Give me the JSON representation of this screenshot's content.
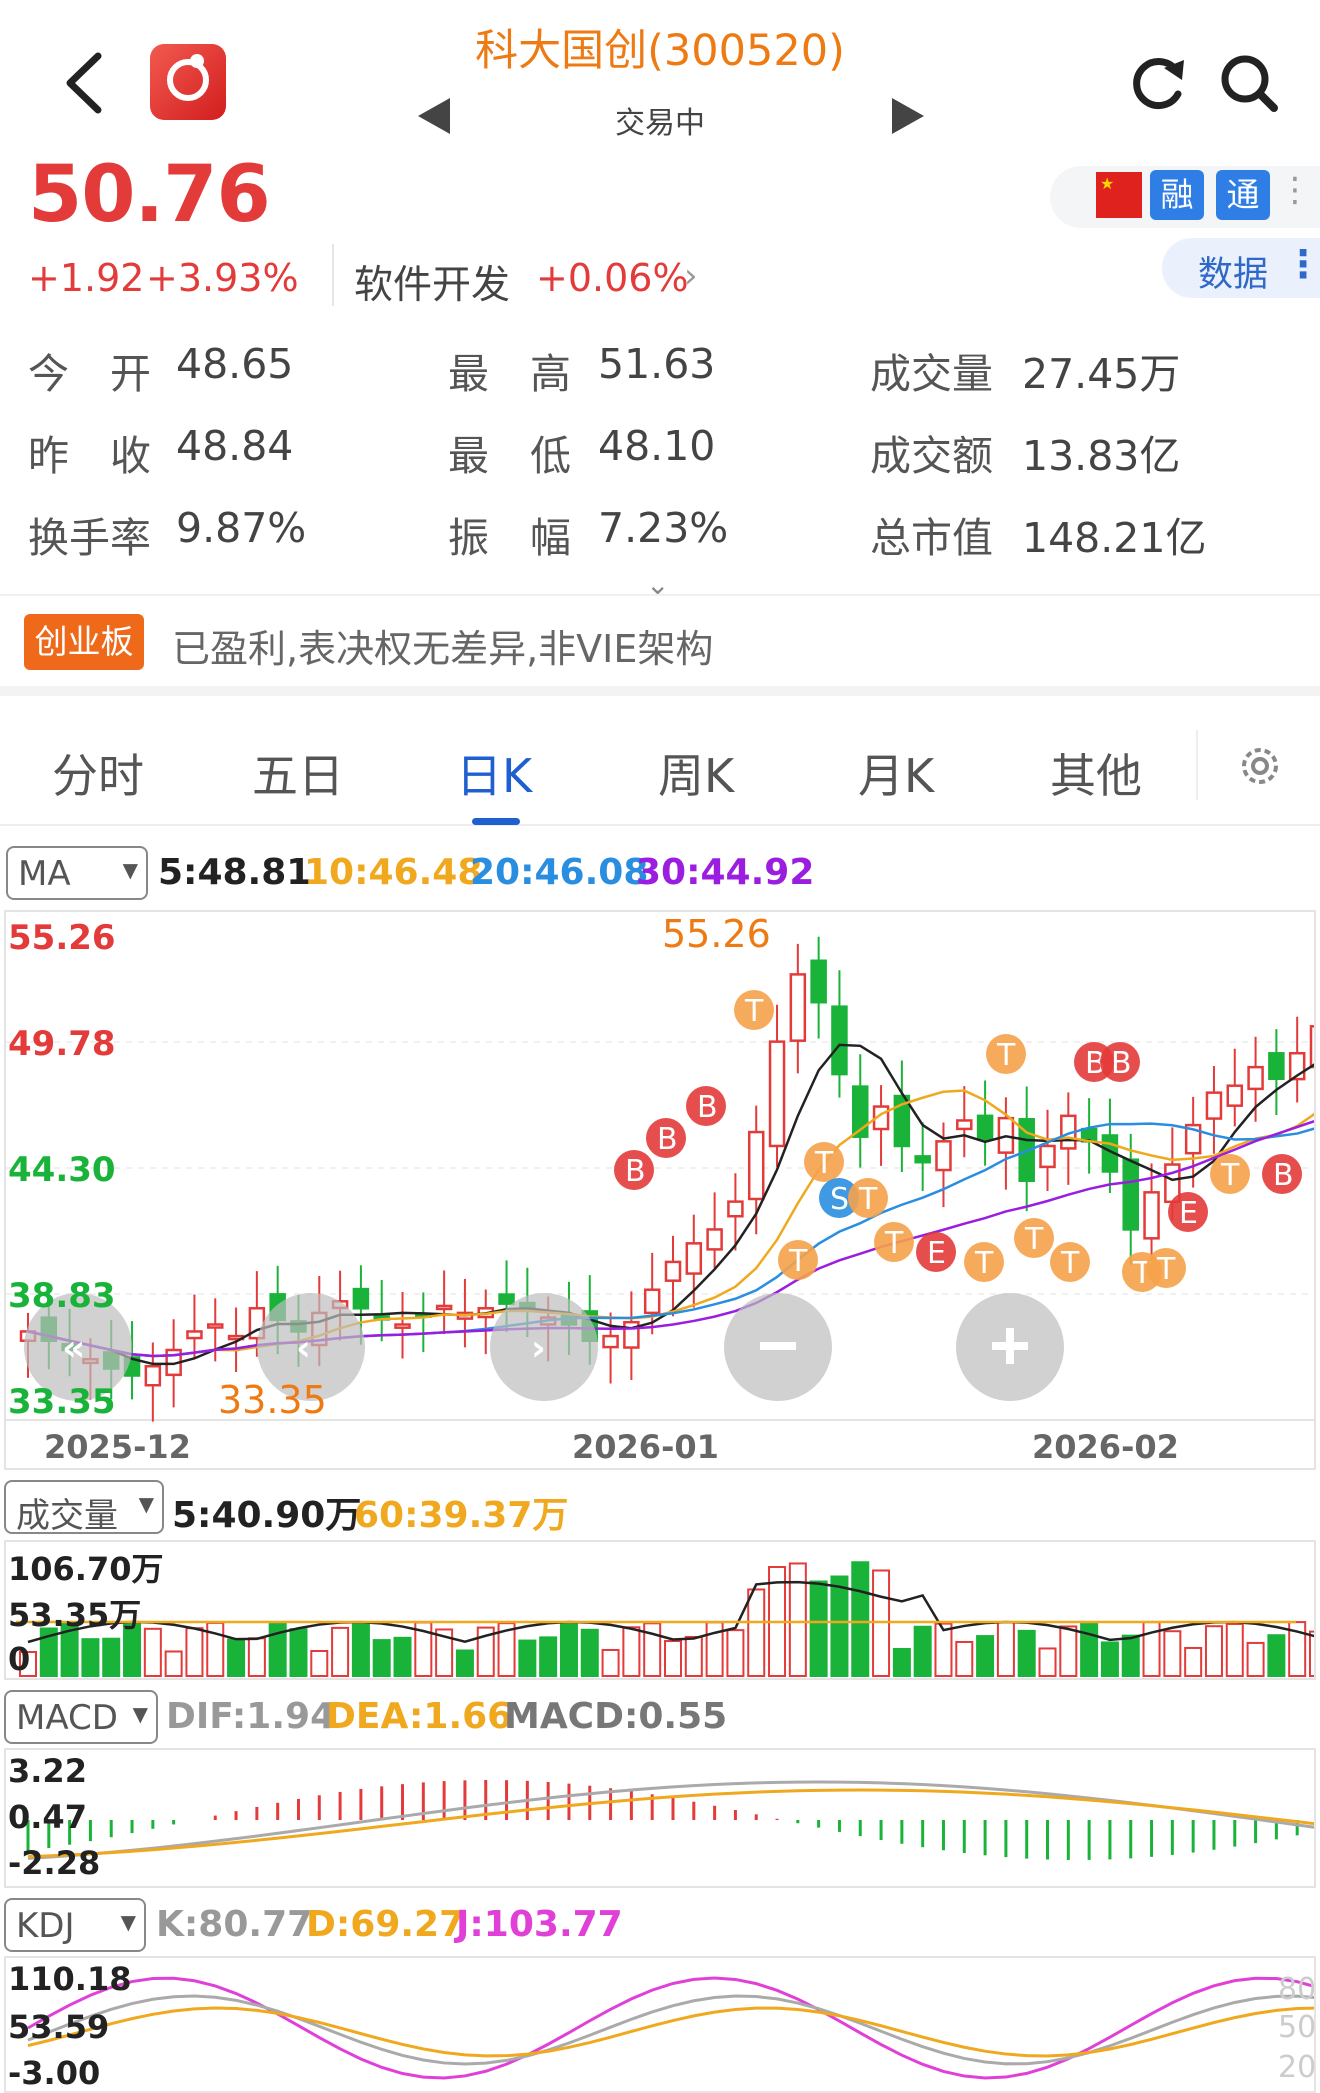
{
  "header": {
    "title": "科大国创(300520)",
    "status": "交易中"
  },
  "quote": {
    "price": "50.76",
    "change": "+1.92",
    "change_pct": "+3.93%",
    "sector": "软件开发",
    "sector_pct": "+0.06%",
    "tags": [
      "融",
      "通"
    ],
    "data_button": "数据"
  },
  "stats": [
    {
      "label": "今　开",
      "value": "48.65"
    },
    {
      "label": "最　高",
      "value": "51.63"
    },
    {
      "label": "成交量",
      "value": "27.45万"
    },
    {
      "label": "昨　收",
      "value": "48.84"
    },
    {
      "label": "最　低",
      "value": "48.10"
    },
    {
      "label": "成交额",
      "value": "13.83亿"
    },
    {
      "label": "换手率",
      "value": "9.87%"
    },
    {
      "label": "振　幅",
      "value": "7.23%"
    },
    {
      "label": "总市值",
      "value": "148.21亿"
    }
  ],
  "board": {
    "tag": "创业板",
    "text": "已盈利,表决权无差异,非VIE架构"
  },
  "tabs": [
    "分时",
    "五日",
    "日K",
    "周K",
    "月K",
    "其他"
  ],
  "active_tab": "日K",
  "ma": {
    "selector": "MA",
    "ma5": "5:48.81",
    "ma10": "10:46.48",
    "ma20": "20:46.08",
    "ma30": "30:44.92"
  },
  "kline_axis": {
    "y_labels": [
      "55.26",
      "49.78",
      "44.30",
      "38.83",
      "33.35"
    ],
    "x_labels": [
      "2025-12",
      "2026-01",
      "2026-02"
    ],
    "high_marker": "55.26",
    "low_marker": "33.35"
  },
  "volume": {
    "selector": "成交量",
    "ma5": "5:40.90万",
    "ma60": "60:39.37万",
    "y_labels": [
      "106.70万",
      "53.35万",
      "0"
    ]
  },
  "macd": {
    "selector": "MACD",
    "dif": "DIF:1.94",
    "dea": "DEA:1.66",
    "macd": "MACD:0.55",
    "y_labels": [
      "3.22",
      "0.47",
      "-2.28"
    ]
  },
  "kdj": {
    "selector": "KDJ",
    "k": "K:80.77",
    "d": "D:69.27",
    "j": "J:103.77",
    "y_labels": [
      "110.18",
      "53.59",
      "-3.00"
    ],
    "right_labels": [
      "80",
      "50",
      "20"
    ]
  },
  "colors": {
    "up": "#e33a3a",
    "down": "#1ab33a",
    "ma5": "#222222",
    "ma10": "#f0a81e",
    "ma20": "#2a8ee0",
    "ma30": "#9a1de0",
    "accent": "#1f5fd0",
    "title_orange": "#ee7a14"
  },
  "chart_data": {
    "type": "candlestick",
    "x_range": [
      "2025-12",
      "2026-02"
    ],
    "ylim": [
      33.35,
      55.26
    ],
    "annotated_high": 55.26,
    "annotated_low": 33.35,
    "last_close": 50.76
  }
}
